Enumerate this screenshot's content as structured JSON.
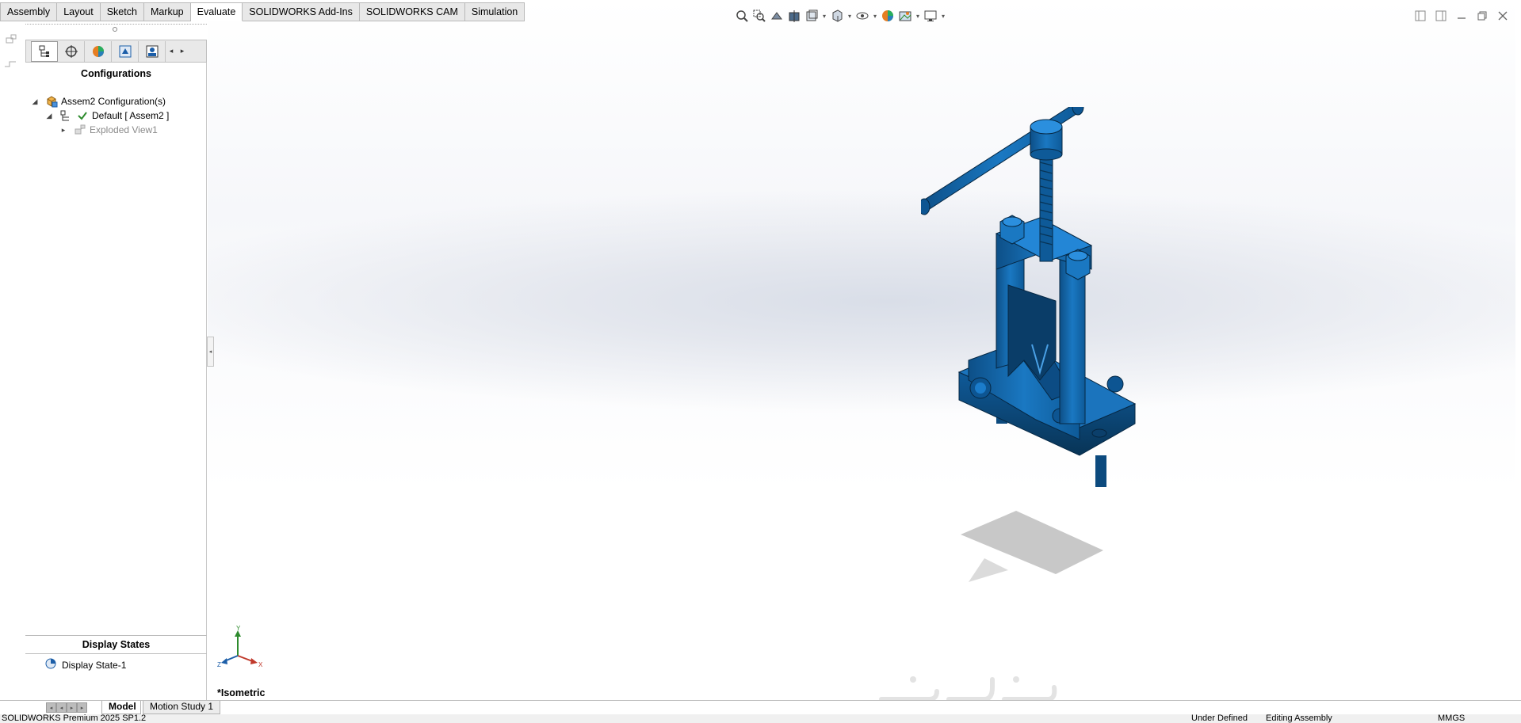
{
  "tabs": [
    {
      "label": "Assembly"
    },
    {
      "label": "Layout"
    },
    {
      "label": "Sketch"
    },
    {
      "label": "Markup"
    },
    {
      "label": "Evaluate"
    },
    {
      "label": "SOLIDWORKS Add-Ins"
    },
    {
      "label": "SOLIDWORKS CAM"
    },
    {
      "label": "Simulation"
    }
  ],
  "active_tab": "Evaluate",
  "feature_manager": {
    "configurations_title": "Configurations",
    "tree": [
      {
        "label": "Assem2 Configuration(s)",
        "icon": "assembly-config-icon",
        "expanded": true
      },
      {
        "label": "Default [ Assem2 ]",
        "icon": "configuration-icon",
        "active": true
      },
      {
        "label": "Exploded View1",
        "icon": "exploded-view-icon",
        "dimmed": true
      }
    ],
    "display_states_title": "Display States",
    "display_state": "Display State-1"
  },
  "viewport": {
    "view_label": "*Isometric",
    "triad": {
      "x": "X",
      "y": "Y",
      "z": "Z"
    }
  },
  "bottom_tabs": {
    "model": "Model",
    "motion_study": "Motion Study 1"
  },
  "status_bar": {
    "product": "SOLIDWORKS Premium 2025 SP1.2",
    "definition": "Under Defined",
    "mode": "Editing Assembly",
    "units": "MMGS"
  },
  "colors": {
    "model_blue": "#1a6fb5",
    "model_dark": "#0b3f6b",
    "tab_active_bg": "#ffffff",
    "tab_bg": "#e8e8e8"
  }
}
